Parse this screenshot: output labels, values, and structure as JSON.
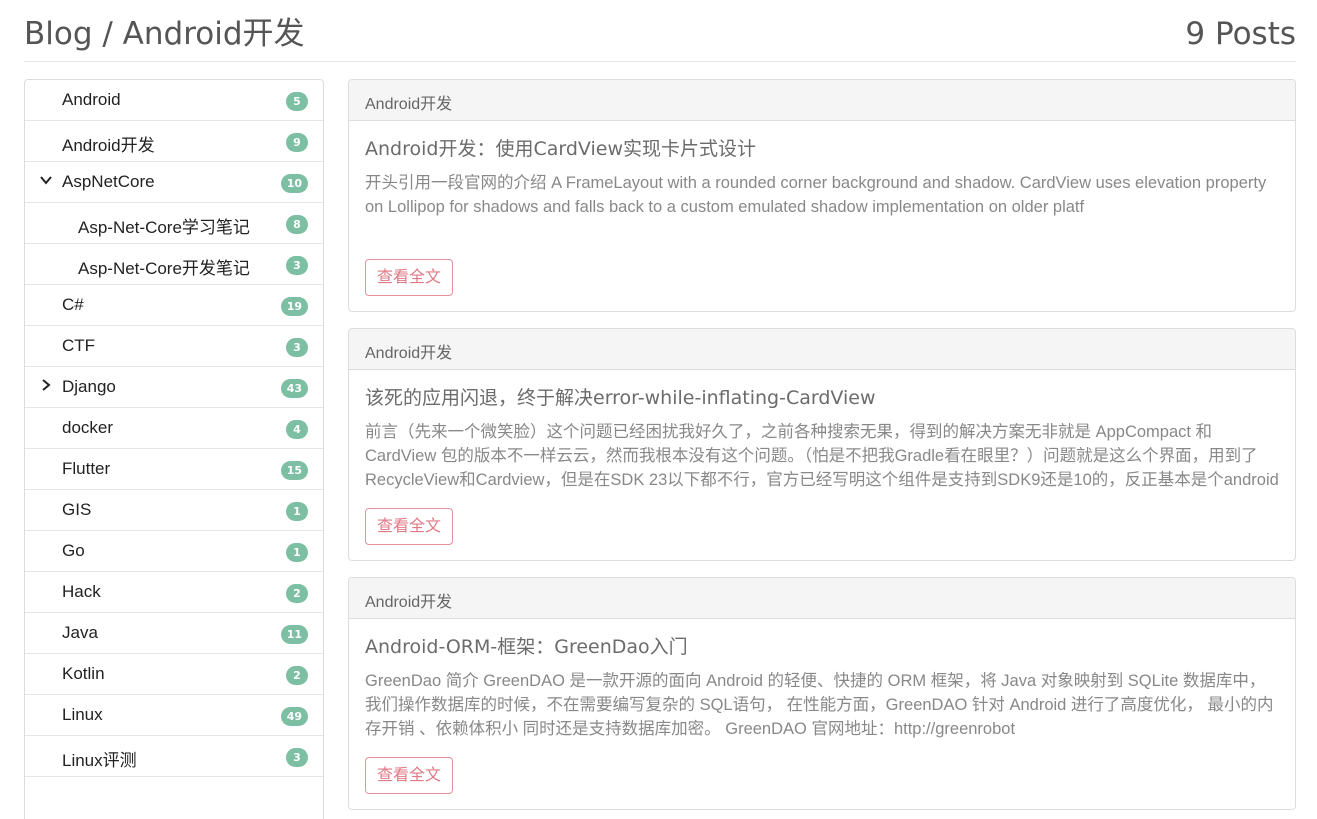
{
  "header": {
    "title": "Blog / Android开发",
    "post_count": "9 Posts"
  },
  "sidebar": {
    "categories": [
      {
        "label": "Android",
        "count": "5",
        "toggle": ""
      },
      {
        "label": "Android开发",
        "count": "9",
        "toggle": ""
      },
      {
        "label": "AspNetCore",
        "count": "10",
        "toggle": "chevron-down-icon"
      },
      {
        "label": "Asp-Net-Core学习笔记",
        "count": "8",
        "toggle": "",
        "sub": true
      },
      {
        "label": "Asp-Net-Core开发笔记",
        "count": "3",
        "toggle": "",
        "sub": true
      },
      {
        "label": "C#",
        "count": "19",
        "toggle": ""
      },
      {
        "label": "CTF",
        "count": "3",
        "toggle": ""
      },
      {
        "label": "Django",
        "count": "43",
        "toggle": "chevron-right-icon"
      },
      {
        "label": "docker",
        "count": "4",
        "toggle": ""
      },
      {
        "label": "Flutter",
        "count": "15",
        "toggle": ""
      },
      {
        "label": "GIS",
        "count": "1",
        "toggle": ""
      },
      {
        "label": "Go",
        "count": "1",
        "toggle": ""
      },
      {
        "label": "Hack",
        "count": "2",
        "toggle": ""
      },
      {
        "label": "Java",
        "count": "11",
        "toggle": ""
      },
      {
        "label": "Kotlin",
        "count": "2",
        "toggle": ""
      },
      {
        "label": "Linux",
        "count": "49",
        "toggle": ""
      },
      {
        "label": "Linux评测",
        "count": "3",
        "toggle": ""
      }
    ]
  },
  "posts": [
    {
      "category": "Android开发",
      "title": "Android开发：使用CardView实现卡片式设计",
      "summary": "开头引用一段官网的介绍 A FrameLayout with a rounded corner background and shadow. CardView uses elevation property on Lollipop for shadows and falls back to a custom emulated shadow implementation on older platf",
      "more_label": "查看全文"
    },
    {
      "category": "Android开发",
      "title": "该死的应用闪退，终于解决error-while-inflating-CardView",
      "summary": "前言（先来一个微笑脸）这个问题已经困扰我好久了，之前各种搜索无果，得到的解决方案无非就是 AppCompact 和 CardView 包的版本不一样云云，然而我根本没有这个问题。（怕是不把我Gradle看在眼里？）问题就是这么个界面，用到了RecycleView和Cardview，但是在SDK 23以下都不行，官方已经写明这个组件是支持到SDK9还是10的，反正基本是个android手机就可",
      "more_label": "查看全文"
    },
    {
      "category": "Android开发",
      "title": "Android-ORM-框架：GreenDao入门",
      "summary": "GreenDao 简介 GreenDAO 是一款开源的面向 Android 的轻便、快捷的 ORM 框架，将 Java 对象映射到 SQLite 数据库中，我们操作数据库的时候，不在需要编写复杂的 SQL语句， 在性能方面，GreenDAO 针对 Android 进行了高度优化， 最小的内存开销 、依赖体积小 同时还是支持数据库加密。 GreenDAO 官网地址：http://greenrobot",
      "more_label": "查看全文"
    }
  ],
  "colors": {
    "badge": "#7dbfa3",
    "more_button": "#e07a86"
  }
}
